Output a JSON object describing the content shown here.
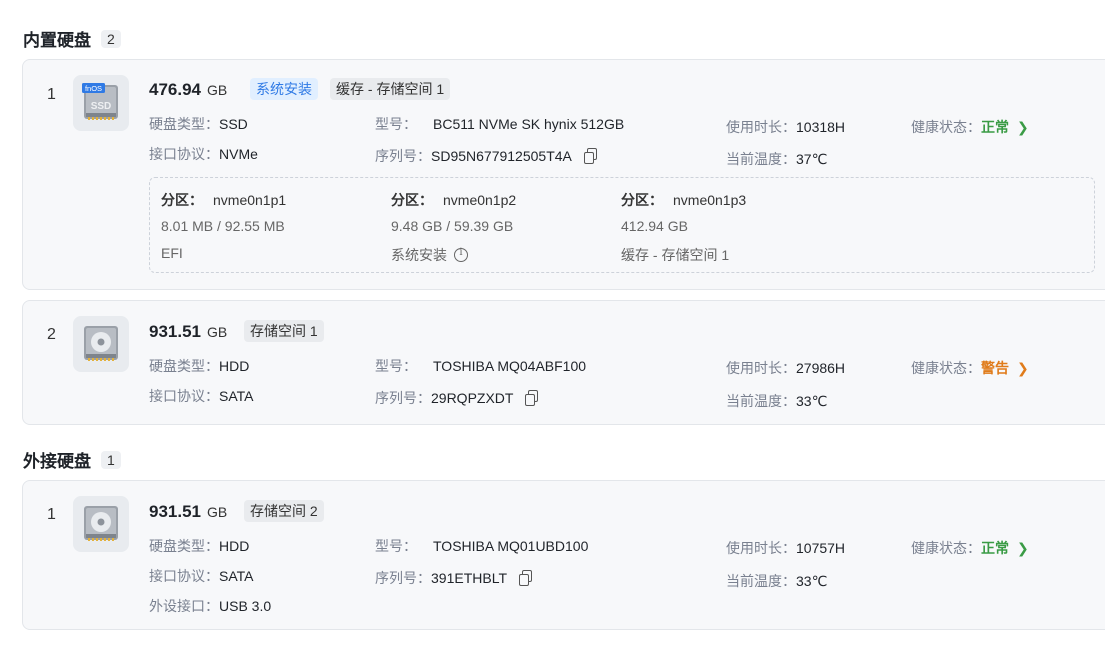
{
  "internal": {
    "title": "内置硬盘",
    "count": "2",
    "disks": [
      {
        "index": "1",
        "icon": "ssd-disk-icon",
        "icon_badge": "fnOS",
        "icon_text": "SSD",
        "capacity": "476.94",
        "unit": "GB",
        "tags": [
          "系统安装",
          "缓存 - 存储空间 1"
        ],
        "type_label": "硬盘类型：",
        "type": "SSD",
        "iface_label": "接口协议：",
        "iface": "NVMe",
        "model_label": "型号：",
        "model": "BC511 NVMe SK hynix 512GB",
        "serial_label": "序列号：",
        "serial": "SD95N677912505T4A",
        "hours_label": "使用时长：",
        "hours": "10318H",
        "temp_label": "当前温度：",
        "temp": "37℃",
        "health_label": "健康状态：",
        "health": "正常",
        "partitions": [
          {
            "label": "分区：",
            "name": "nvme0n1p1",
            "size": "8.01 MB / 92.55 MB",
            "usage": "EFI"
          },
          {
            "label": "分区：",
            "name": "nvme0n1p2",
            "size": "9.48 GB / 59.39 GB",
            "usage": "系统安装"
          },
          {
            "label": "分区：",
            "name": "nvme0n1p3",
            "size": "412.94 GB",
            "usage": "缓存 - 存储空间 1"
          }
        ]
      },
      {
        "index": "2",
        "icon": "hdd-disk-icon",
        "capacity": "931.51",
        "unit": "GB",
        "tags": [
          "存储空间 1"
        ],
        "type_label": "硬盘类型：",
        "type": "HDD",
        "iface_label": "接口协议：",
        "iface": "SATA",
        "model_label": "型号：",
        "model": "TOSHIBA MQ04ABF100",
        "serial_label": "序列号：",
        "serial": "29RQPZXDT",
        "hours_label": "使用时长：",
        "hours": "27986H",
        "temp_label": "当前温度：",
        "temp": "33℃",
        "health_label": "健康状态：",
        "health": "警告"
      }
    ]
  },
  "external": {
    "title": "外接硬盘",
    "count": "1",
    "disks": [
      {
        "index": "1",
        "icon": "hdd-disk-icon",
        "capacity": "931.51",
        "unit": "GB",
        "tags": [
          "存储空间 2"
        ],
        "type_label": "硬盘类型：",
        "type": "HDD",
        "iface_label": "接口协议：",
        "iface": "SATA",
        "port_label": "外设接口：",
        "port": "USB 3.0",
        "model_label": "型号：",
        "model": "TOSHIBA MQ01UBD100",
        "serial_label": "序列号：",
        "serial": "391ETHBLT",
        "hours_label": "使用时长：",
        "hours": "10757H",
        "temp_label": "当前温度：",
        "temp": "33℃",
        "health_label": "健康状态：",
        "health": "正常"
      }
    ]
  },
  "colors": {
    "ok": "#3a9b45",
    "warn": "#e07b1a",
    "tag_blue_bg": "#e1efff",
    "tag_blue_text": "#2f7ae5",
    "card_bg": "#f7f8fa"
  }
}
